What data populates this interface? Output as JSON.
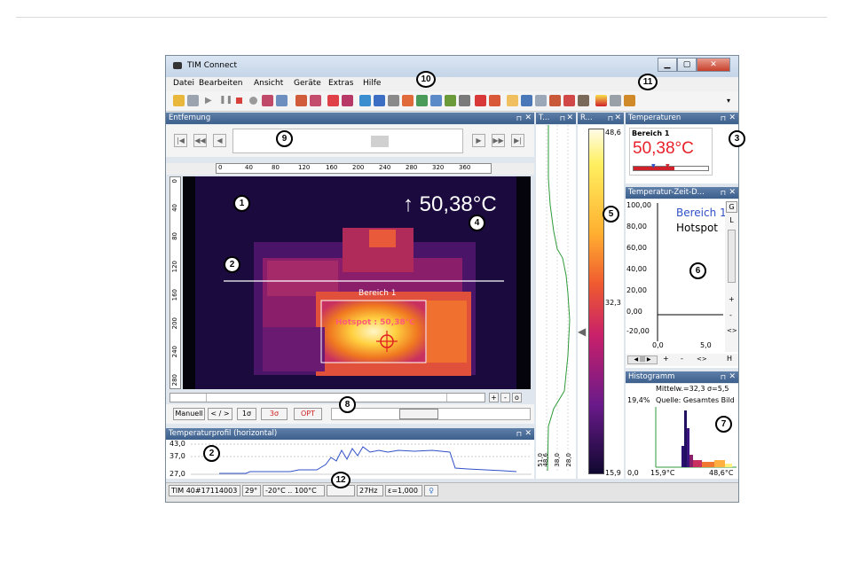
{
  "window": {
    "title": "TIM Connect"
  },
  "menu": [
    "Datei",
    "Bearbeiten",
    "Ansicht",
    "Geräte",
    "Extras",
    "Hilfe"
  ],
  "panels": {
    "entfernung": "Entfernung",
    "temp_profile_v": "T...",
    "range": "R...",
    "temperaturen": "Temperaturen",
    "temp_time": "Temperatur-Zeit-D...",
    "histogramm": "Histogramm",
    "temp_profile_h": "Temperaturprofil (horizontal)"
  },
  "ruler_h": [
    "0",
    "40",
    "80",
    "120",
    "160",
    "200",
    "240",
    "280",
    "320",
    "360"
  ],
  "ruler_v": [
    "0",
    "40",
    "80",
    "120",
    "160",
    "200",
    "240",
    "280"
  ],
  "thermal": {
    "max_temp": "↑ 50,38°C",
    "area_label": "Bereich 1",
    "hotspot_label": "Hotspot : 50,38°C"
  },
  "scale": {
    "max": "48,6",
    "mid": "32,3",
    "min": "15,9"
  },
  "vprofile_ticks": [
    "51,0",
    "48,6",
    "38,0",
    "28,0"
  ],
  "temperaturen": {
    "area": "Bereich 1",
    "value": "50,38°C"
  },
  "temp_time": {
    "y_ticks": [
      "100,00",
      "80,00",
      "60,00",
      "40,00",
      "20,00",
      "0,00",
      "-20,00"
    ],
    "x_ticks": [
      "0,0",
      "5,0"
    ],
    "legend": [
      "Bereich 1",
      "Hotspot"
    ],
    "side_buttons": [
      "G",
      "L",
      "+",
      "-",
      "<>",
      "H"
    ],
    "scroll_bottom": [
      "+",
      "-",
      "<>",
      "H"
    ]
  },
  "histogramm": {
    "stats_line": "Mittelw.=32,3 σ=5,5",
    "peak": "19,4%",
    "source": "Quelle: Gesamtes Bild",
    "x_start": "0,0",
    "x_min": "15,9°C",
    "x_max": "48,6°C"
  },
  "buttons": {
    "manuell": "Manuell",
    "range": "< / >",
    "one_sigma": "1σ",
    "three_sigma": "3σ",
    "opt": "OPT"
  },
  "profile_h": {
    "y_ticks": [
      "43,0",
      "37,0",
      "27,0"
    ]
  },
  "status": [
    "TIM 40#17114003",
    "29°",
    "-20°C .. 100°C",
    "",
    "27Hz",
    "ε=1,000"
  ],
  "callouts": [
    "1",
    "2",
    "2",
    "3",
    "4",
    "5",
    "6",
    "7",
    "8",
    "9",
    "10",
    "11",
    "12"
  ],
  "colors": {
    "accent": "#3c5f8c",
    "temp_red": "#e8202a",
    "curve_green": "#2f9a3a",
    "curve_blue": "#3050c8"
  }
}
